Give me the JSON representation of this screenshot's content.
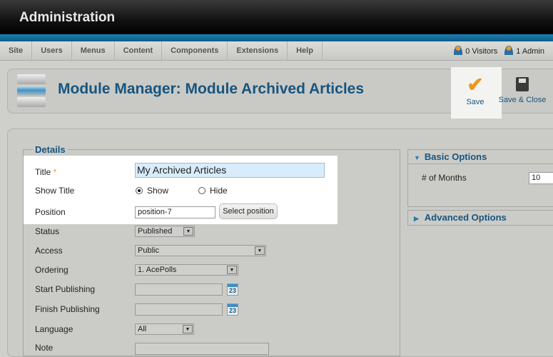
{
  "header": {
    "title": "Administration"
  },
  "menu": [
    "Site",
    "Users",
    "Menus",
    "Content",
    "Components",
    "Extensions",
    "Help"
  ],
  "status": {
    "visitors": "0 Visitors",
    "admins": "1 Admin"
  },
  "toolbar": {
    "title": "Module Manager: Module Archived Articles",
    "save": "Save",
    "save_close": "Save & Close"
  },
  "details": {
    "legend": "Details",
    "title_label": "Title",
    "required": "*",
    "title_value": "My Archived Articles",
    "show_title_label": "Show Title",
    "show": "Show",
    "hide": "Hide",
    "position_label": "Position",
    "position_value": "position-7",
    "select_position": "Select position",
    "status_label": "Status",
    "status_value": "Published",
    "access_label": "Access",
    "access_value": "Public",
    "ordering_label": "Ordering",
    "ordering_value": "1. AcePolls",
    "start_label": "Start Publishing",
    "finish_label": "Finish Publishing",
    "calendar_day": "23",
    "language_label": "Language",
    "language_value": "All",
    "note_label": "Note"
  },
  "options": {
    "basic": "Basic Options",
    "months_label": "# of Months",
    "months_value": "10",
    "advanced": "Advanced Options"
  }
}
